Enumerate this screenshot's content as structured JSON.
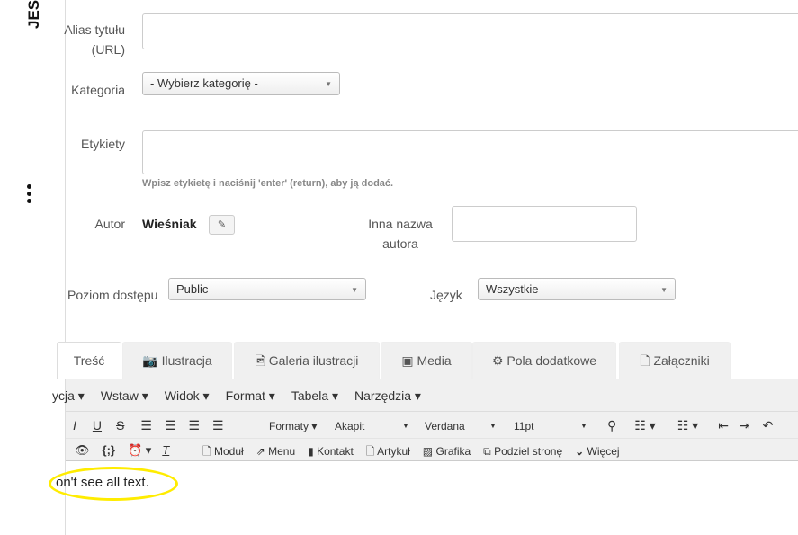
{
  "sidebar": {
    "vertical_title": "JES"
  },
  "form": {
    "alias_label": "Alias tytułu (URL)",
    "alias_value": "",
    "category_label": "Kategoria",
    "category_value": "- Wybierz kategorię -",
    "tags_label": "Etykiety",
    "tags_hint": "Wpisz etykietę i naciśnij 'enter' (return), aby ją dodać.",
    "author_label": "Autor",
    "author_value": "Wieśniak",
    "alias_author_label": "Inna nazwa autora",
    "alias_author_value": "",
    "access_label": "Poziom dostępu",
    "access_value": "Public",
    "language_label": "Język",
    "language_value": "Wszystkie"
  },
  "tabs": [
    "Treść",
    "Ilustracja",
    "Galeria ilustracji",
    "Media",
    "Pola dodatkowe",
    "Załączniki"
  ],
  "editor": {
    "menu": [
      "ycja ▾",
      "Wstaw ▾",
      "Widok ▾",
      "Format ▾",
      "Tabela ▾",
      "Narzędzia ▾"
    ],
    "formats": "Formaty ▾",
    "block": "Akapit",
    "font": "Verdana",
    "size": "11pt",
    "buttons": [
      "Moduł",
      "Menu",
      "Kontakt",
      "Artykuł",
      "Grafika",
      "Podziel stronę",
      "Więcej"
    ],
    "content": "on't see all text."
  }
}
